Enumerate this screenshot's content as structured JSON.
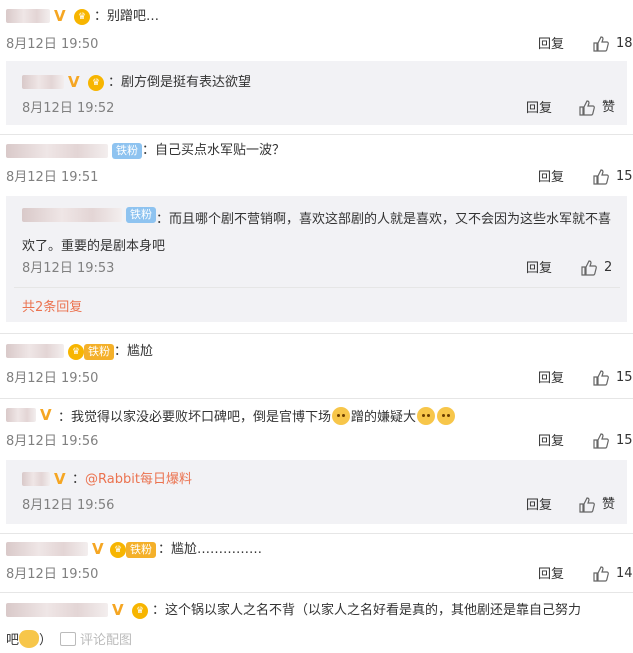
{
  "comments": [
    {
      "text": "：别蹭吧…",
      "time": "8月12日 19:50",
      "reply": "回复",
      "likes": "18"
    },
    {
      "text": "：剧方倒是挺有表达欲望",
      "time": "8月12日 19:52",
      "reply": "回复",
      "likes": "赞"
    },
    {
      "fan_badge": "铁粉",
      "text": "：自己买点水军贴一波？",
      "time": "8月12日 19:51",
      "reply": "回复",
      "likes": "15"
    },
    {
      "fan_badge": "铁粉",
      "text": "：而且哪个剧不营销啊，喜欢这部剧的人就是喜欢，又不会因为这些水军就不喜欢了。重要的是剧本身吧",
      "time": "8月12日 19:53",
      "reply": "回复",
      "likes": "2"
    },
    {
      "more": "共2条回复"
    },
    {
      "fan_badge": "铁粉",
      "text": "：尴尬",
      "time": "8月12日 19:50",
      "reply": "回复",
      "likes": "15"
    },
    {
      "text_a": "：我觉得以家没必要败坏口碑吧，倒是官博下场",
      "text_b": "蹭的嫌疑大",
      "time": "8月12日 19:56",
      "reply": "回复",
      "likes": "15"
    },
    {
      "text_prefix": "：",
      "mention": "@Rabbit每日爆料",
      "time": "8月12日 19:56",
      "reply": "回复",
      "likes": "赞"
    },
    {
      "fan_badge": "铁粉",
      "text": "：尴尬……………",
      "time": "8月12日 19:50",
      "reply": "回复",
      "likes": "14"
    },
    {
      "text_a": "：这个锅以家人之名不背（以家人之名好看是真的，其他剧还是靠自己努力",
      "text_b": "吧",
      "text_c": "）",
      "pic_link": "评论配图"
    }
  ],
  "colors": {
    "accent": "#eb7350",
    "badge_blue": "#8ec3f0",
    "badge_orange": "#f4b02a"
  }
}
